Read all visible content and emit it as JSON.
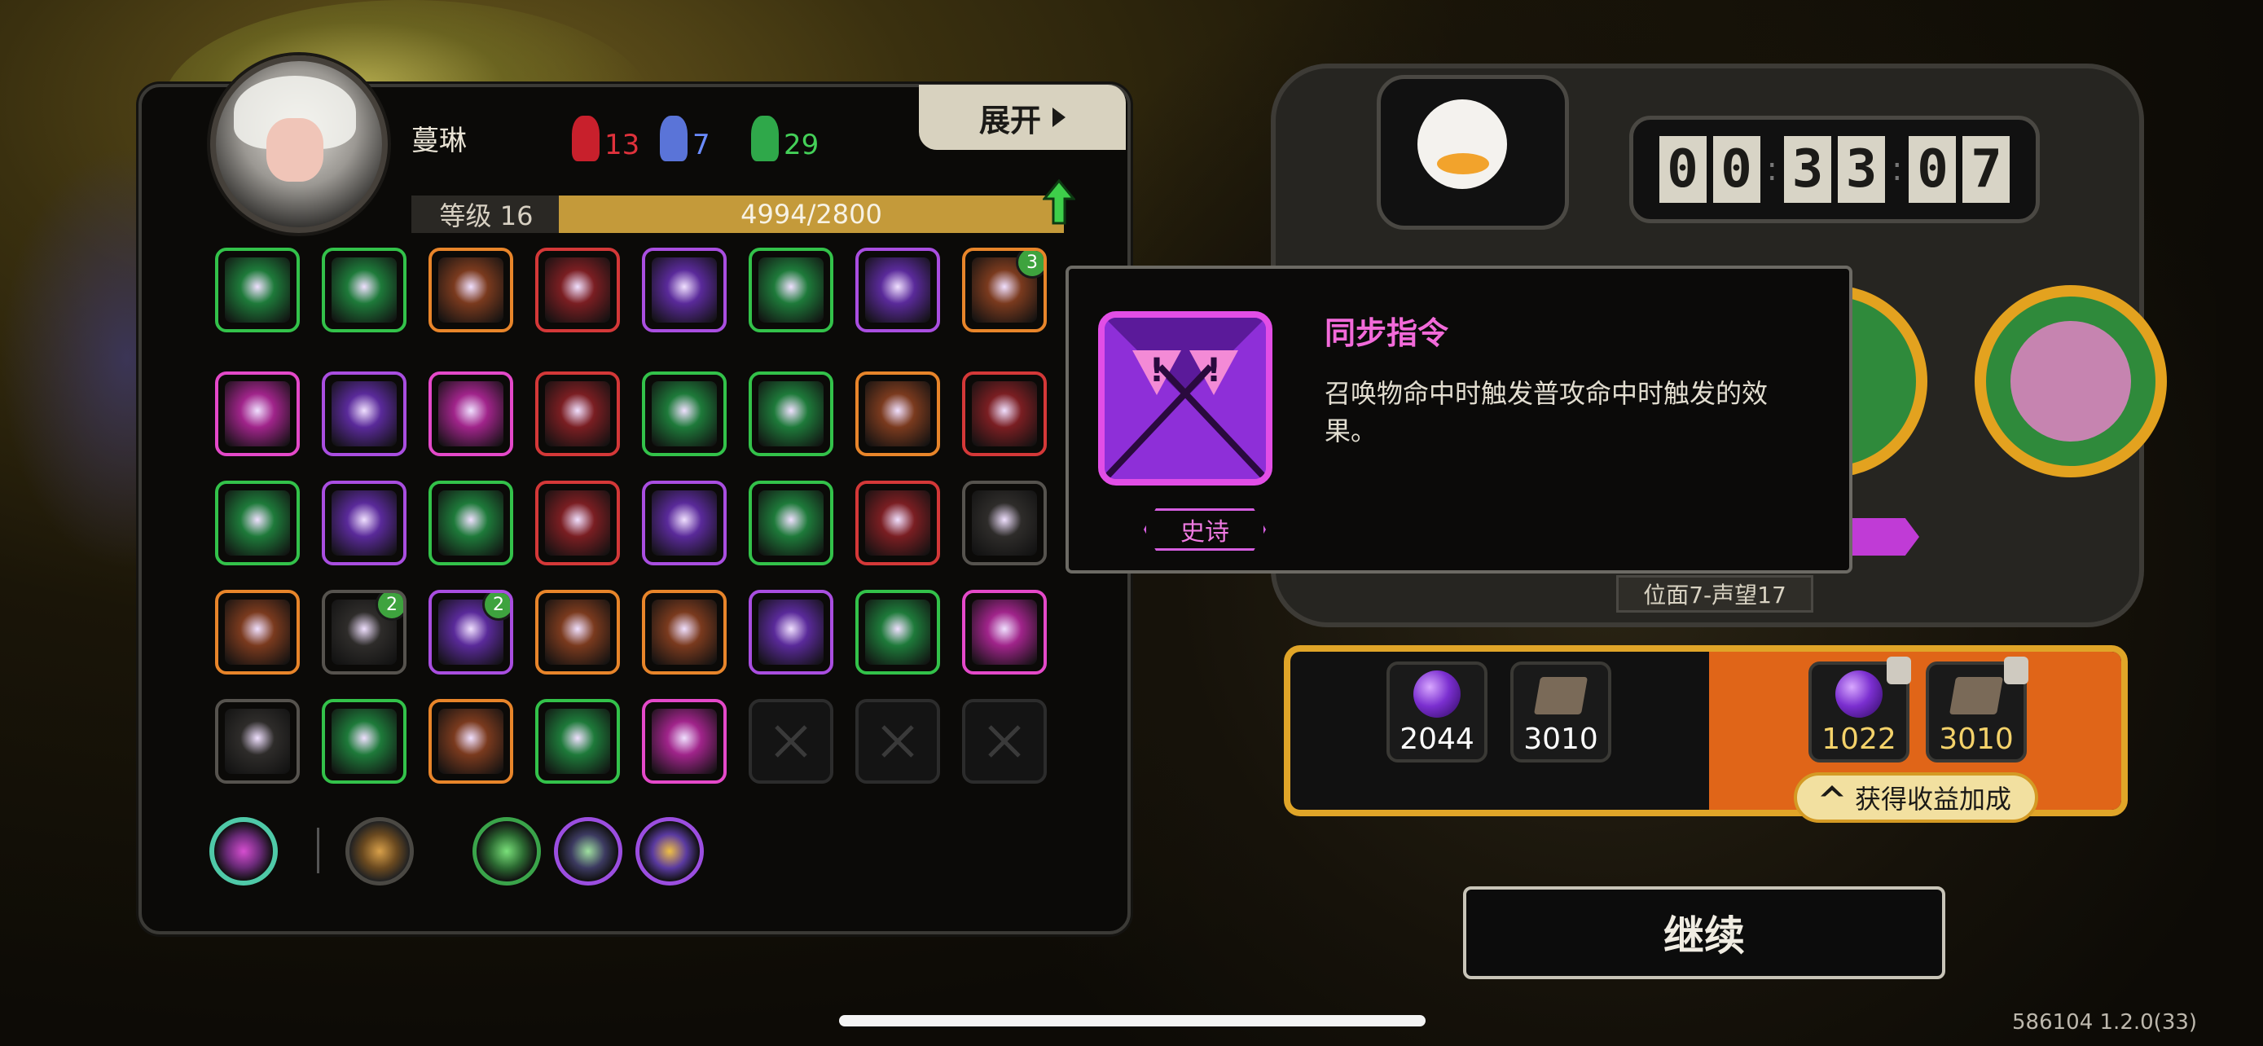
{
  "player": {
    "name": "蔓琳",
    "level_label": "等级 16",
    "xp_text": "4994/2800"
  },
  "resources": [
    {
      "name": "red-horn",
      "value": "13",
      "color": "#e0323c"
    },
    {
      "name": "blue-horn",
      "value": "7",
      "color": "#6b8cff"
    },
    {
      "name": "green-horn",
      "value": "29",
      "color": "#44d058"
    }
  ],
  "expand_button": {
    "label": "展开"
  },
  "skills": [
    {
      "rarity": "green",
      "badge": ""
    },
    {
      "rarity": "green",
      "badge": ""
    },
    {
      "rarity": "orange",
      "badge": ""
    },
    {
      "rarity": "red",
      "badge": ""
    },
    {
      "rarity": "purple",
      "badge": ""
    },
    {
      "rarity": "green",
      "badge": ""
    },
    {
      "rarity": "purple",
      "badge": ""
    },
    {
      "rarity": "orange",
      "badge": "3"
    },
    {
      "rarity": "pink",
      "badge": ""
    },
    {
      "rarity": "purple",
      "badge": ""
    },
    {
      "rarity": "pink",
      "badge": ""
    },
    {
      "rarity": "red",
      "badge": ""
    },
    {
      "rarity": "green",
      "badge": ""
    },
    {
      "rarity": "green",
      "badge": ""
    },
    {
      "rarity": "orange",
      "badge": ""
    },
    {
      "rarity": "red",
      "badge": ""
    },
    {
      "rarity": "green",
      "badge": ""
    },
    {
      "rarity": "purple",
      "badge": ""
    },
    {
      "rarity": "green",
      "badge": ""
    },
    {
      "rarity": "red",
      "badge": ""
    },
    {
      "rarity": "purple",
      "badge": ""
    },
    {
      "rarity": "green",
      "badge": ""
    },
    {
      "rarity": "red",
      "badge": ""
    },
    {
      "rarity": "gray",
      "badge": ""
    },
    {
      "rarity": "orange",
      "badge": ""
    },
    {
      "rarity": "gray",
      "badge": "2"
    },
    {
      "rarity": "purple",
      "badge": "2"
    },
    {
      "rarity": "orange",
      "badge": ""
    },
    {
      "rarity": "orange",
      "badge": ""
    },
    {
      "rarity": "purple",
      "badge": ""
    },
    {
      "rarity": "green",
      "badge": ""
    },
    {
      "rarity": "pink",
      "badge": ""
    },
    {
      "rarity": "gray",
      "badge": ""
    },
    {
      "rarity": "green",
      "badge": ""
    },
    {
      "rarity": "orange",
      "badge": ""
    },
    {
      "rarity": "green",
      "badge": ""
    },
    {
      "rarity": "pink",
      "badge": ""
    },
    {
      "rarity": "empty",
      "badge": ""
    },
    {
      "rarity": "empty",
      "badge": ""
    },
    {
      "rarity": "empty",
      "badge": ""
    }
  ],
  "timer": {
    "digits": [
      "0",
      "0",
      "3",
      "3",
      "0",
      "7"
    ]
  },
  "reputation_label": "位面7-声望17",
  "rewards": {
    "base": [
      {
        "icon": "purple-gem",
        "value": "2044"
      },
      {
        "icon": "book",
        "value": "3010"
      }
    ],
    "bonus": [
      {
        "icon": "purple-gem",
        "value": "1022"
      },
      {
        "icon": "book",
        "value": "3010"
      }
    ],
    "bonus_button": "获得收益加成"
  },
  "tooltip": {
    "title": "同步指令",
    "description": "召唤物命中时触发普攻命中时触发的效果。",
    "rarity": "史诗"
  },
  "continue_button": "继续",
  "version": "586104 1.2.0(33)",
  "colors": {
    "gold": "#e0a528",
    "epic": "#e24ee6",
    "bonus_orange": "#e06518"
  }
}
